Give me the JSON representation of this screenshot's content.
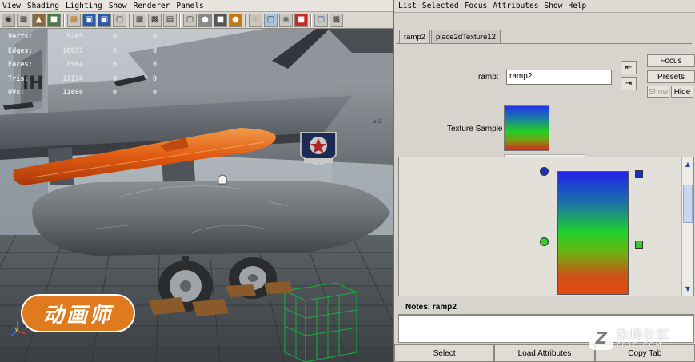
{
  "viewport": {
    "menu": [
      "View",
      "Shading",
      "Lighting",
      "Show",
      "Renderer",
      "Panels"
    ],
    "toolbar_icons": [
      "select-camera-icon",
      "camera-attributes-icon",
      "bookmark-icon",
      "image-plane-icon",
      "grid-icon",
      "film-gate-icon",
      "resolution-gate-icon",
      "safe-action-icon",
      "wireframe-icon",
      "smooth-shade-icon",
      "flat-shade-icon",
      "bounding-box-icon",
      "points-icon",
      "default-light-icon",
      "all-lights-icon",
      "textured-icon",
      "xray-icon",
      "isolate-icon",
      "high-quality-icon",
      "shadows-icon",
      "grid-toggle-icon",
      "frame-icon"
    ],
    "hud": [
      {
        "label": "Verts:",
        "v1": "9205",
        "v2": "0",
        "v3": "0"
      },
      {
        "label": "Edges:",
        "v1": "18057",
        "v2": "0",
        "v3": "0"
      },
      {
        "label": "Faces:",
        "v1": "8904",
        "v2": "0",
        "v3": "0"
      },
      {
        "label": "Tris:",
        "v1": "17174",
        "v2": "0",
        "v3": "0"
      },
      {
        "label": "UVs:",
        "v1": "11600",
        "v2": "0",
        "v3": "0"
      }
    ],
    "logo_text": "动画师",
    "axis_label": "y"
  },
  "editor": {
    "menu": [
      "List",
      "Selected",
      "Focus",
      "Attributes",
      "Show",
      "Help"
    ],
    "tabs": [
      {
        "label": "ramp2",
        "active": true
      },
      {
        "label": "place2dTexture12",
        "active": false
      }
    ],
    "ramp_label": "ramp:",
    "ramp_value": "ramp2",
    "buttons": {
      "focus": "Focus",
      "presets": "Presets",
      "show": "Show",
      "hide": "Hide"
    },
    "texture_sample_label": "Texture Sample",
    "notes_label": "Notes:  ramp2",
    "bottom_buttons": [
      "Select",
      "Load Attributes",
      "Copy Tab"
    ],
    "colors": {
      "ramp_top": "#2222ee",
      "ramp_mid": "#22d22a",
      "ramp_bottom": "#e24a10",
      "handle_blue": "#1a2ec8",
      "handle_green": "#33cc33"
    }
  },
  "watermark": {
    "cn": "朱峰社区",
    "en": "ZF3D.COM"
  }
}
